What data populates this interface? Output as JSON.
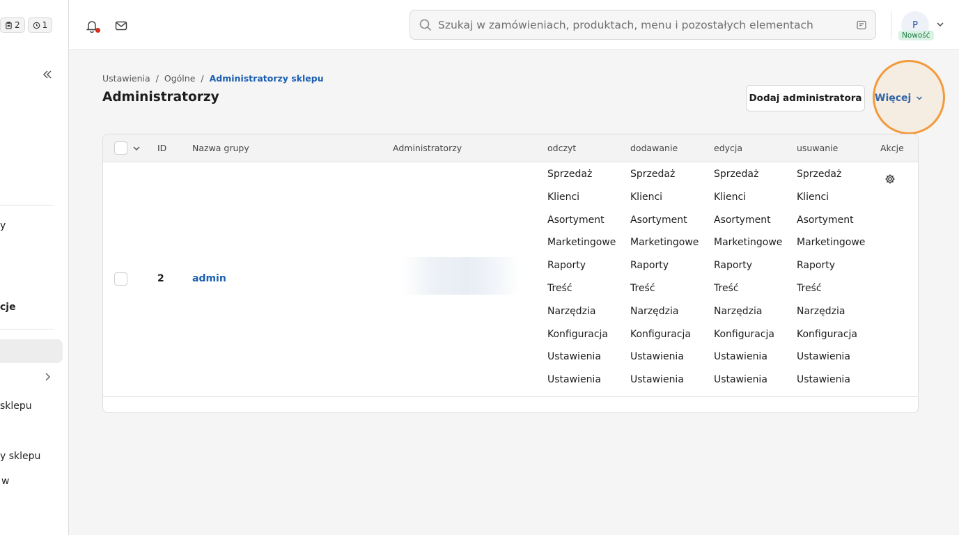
{
  "sidebar": {
    "badges": [
      {
        "icon": "clipboard-icon",
        "count": "2"
      },
      {
        "icon": "clock-icon",
        "count": "1"
      }
    ],
    "fragments": [
      "y",
      "cje",
      "sklepu",
      "y sklepu",
      "w"
    ]
  },
  "header": {
    "search_placeholder": "Szukaj w zamówieniach, produktach, menu i pozostałych elementach",
    "avatar_initial": "P",
    "new_badge": "Nowość"
  },
  "breadcrumb": {
    "items": [
      "Ustawienia",
      "Ogólne",
      "Administratorzy sklepu"
    ],
    "separator": "/"
  },
  "page": {
    "title": "Administratorzy",
    "add_button": "Dodaj administratora",
    "more_button": "Więcej"
  },
  "table": {
    "columns": [
      "ID",
      "Nazwa grupy",
      "Administratorzy",
      "odczyt",
      "dodawanie",
      "edycja",
      "usuwanie",
      "Akcje"
    ],
    "rows": [
      {
        "id": "2",
        "name": "admin",
        "permissions": [
          "Sprzedaż",
          "Klienci",
          "Asortyment",
          "Marketingowe",
          "Raporty",
          "Treść",
          "Narzędzia",
          "Konfiguracja",
          "Ustawienia",
          "Ustawienia"
        ]
      }
    ]
  },
  "colors": {
    "accent": "#1b5fb0",
    "highlight": "#f29a3c",
    "notification": "#d92d20"
  }
}
